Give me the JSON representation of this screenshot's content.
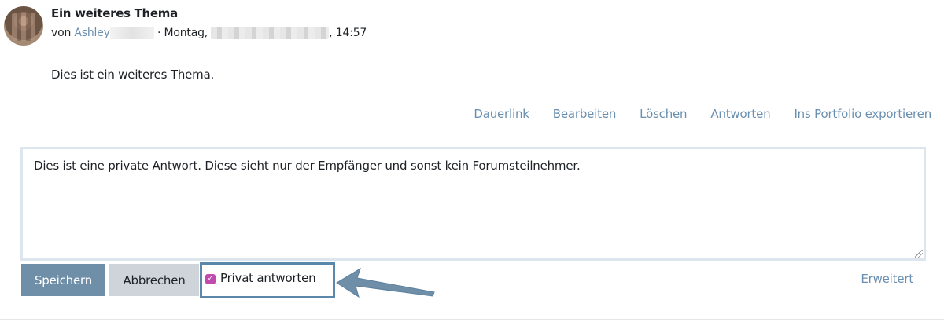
{
  "post": {
    "subject": "Ein weiteres Thema",
    "by_prefix": "von",
    "author": "Ashley",
    "separator": "· Montag,",
    "time": ", 14:57",
    "body": "Dies ist ein weiteres Thema."
  },
  "commands": [
    {
      "label": "Dauerlink"
    },
    {
      "label": "Bearbeiten"
    },
    {
      "label": "Löschen"
    },
    {
      "label": "Antworten"
    },
    {
      "label": "Ins Portfolio exportieren"
    }
  ],
  "reply": {
    "text": "Dies ist eine private Antwort. Diese sieht nur der Empfänger und sonst kein Forumsteilnehmer.",
    "save_label": "Speichern",
    "cancel_label": "Abbrechen",
    "private_label": "Privat antworten",
    "private_checked": true,
    "advanced_label": "Erweitert"
  },
  "colors": {
    "link": "#6a8fb0",
    "save_button": "#6f8ea8",
    "cancel_button": "#ced4da",
    "checkbox": "#c04aae",
    "highlight_box": "#5b87ab"
  }
}
